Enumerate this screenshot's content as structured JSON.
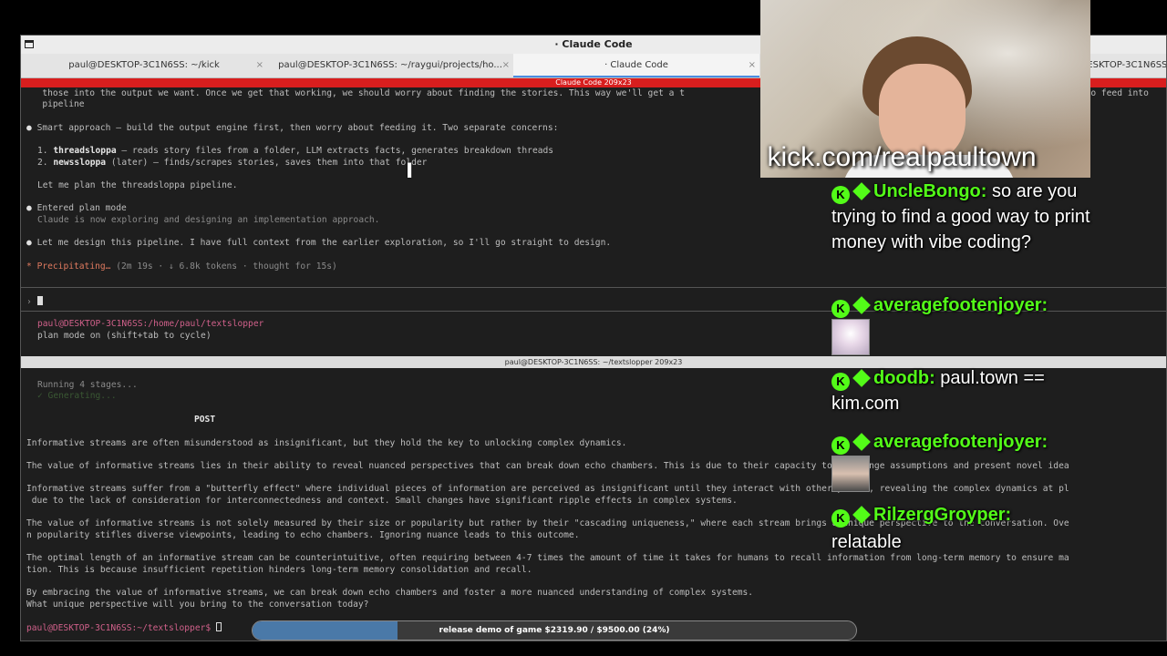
{
  "window": {
    "title": "· Claude Code"
  },
  "tabs": [
    {
      "label": "paul@DESKTOP-3C1N6SS: ~/kick"
    },
    {
      "label": "paul@DESKTOP-3C1N6SS: ~/raygui/projects/ho..."
    },
    {
      "label": "· Claude Code"
    },
    {
      "label": "paul@DESKTOP-3C1N6SS: ~/kick/kick"
    }
  ],
  "tab_close_glyph": "×",
  "top_pane": {
    "banner": "Claude Code 209x23",
    "lines": {
      "l1": "   those into the output we want. Once we get that working, we should worry about finding the stories. This way we'll get a t",
      "l1b": "e to feed into",
      "l2": "   pipeline",
      "l3": "Smart approach — build the output engine first, then worry about feeding it. Two separate concerns:",
      "l4_num": "1. ",
      "l4_bold": "threadsloppa",
      "l4_rest": " — reads story files from a folder, LLM extracts facts, generates breakdown threads",
      "l5_num": "2. ",
      "l5_bold": "newssloppa",
      "l5_rest": " (later) — finds/scrapes stories, saves them into that folder",
      "l6": "Let me plan the threadsloppa pipeline.",
      "l7": "Entered plan mode",
      "l8": "Claude is now exploring and designing an implementation approach.",
      "l9": "Let me design this pipeline. I have full context from the earlier exploration, so I'll go straight to design.",
      "l10_star": "* ",
      "l10_a": "Precipitating…",
      "l10_b": " (2m 19s · ↓ 6.8k tokens · thought for 15s)",
      "prompt": "›",
      "path": "paul@DESKTOP-3C1N6SS:/home/paul/textslopper",
      "mode": "plan mode on (shift+tab to cycle)"
    },
    "bullet": "●"
  },
  "bottom_pane": {
    "title": "paul@DESKTOP-3C1N6SS: ~/textslopper 209x23",
    "running": "Running 4 stages...",
    "done": "✓ Generating...",
    "heading": "POST",
    "p1": "Informative streams are often misunderstood as insignificant, but they hold the key to unlocking complex dynamics.",
    "p2": "The value of informative streams lies in their ability to reveal nuanced perspectives that can break down echo chambers. This is due to their capacity to challenge assumptions and present novel idea",
    "p3a": "Informative streams suffer from a \"butterfly effect\" where individual pieces of information are perceived as insignificant until they interact with other pieces, revealing the complex dynamics at pl",
    "p3b": " due to the lack of consideration for interconnectedness and context. Small changes have significant ripple effects in complex systems.",
    "p4a": "The value of informative streams is not solely measured by their size or popularity but rather by their \"cascading uniqueness,\" where each stream brings a unique perspective to the conversation. Ove",
    "p4b": "n popularity stifles diverse viewpoints, leading to echo chambers. Ignoring nuance leads to this outcome.",
    "p5a": "The optimal length of an informative stream can be counterintuitive, often requiring between 4-7 times the amount of time it takes for humans to recall information from long-term memory to ensure ma",
    "p5b": "tion. This is because insufficient repetition hinders long-term memory consolidation and recall.",
    "p6a": "By embracing the value of informative streams, we can break down echo chambers and foster a more nuanced understanding of complex systems.",
    "p6b": "What unique perspective will you bring to the conversation today?",
    "prompt": "paul@DESKTOP-3C1N6SS:~/textslopper$ "
  },
  "overlay": {
    "kick_url": "kick.com/realpaultown",
    "badge_letter": "K",
    "chat": [
      {
        "user": "UncleBongo:",
        "text": " so are you trying to find a good way to print money with vibe coding?"
      },
      {
        "user": "averagefootenjoyer:",
        "text": ""
      },
      {
        "user": "doodb:",
        "text": " paul.town == kim.com"
      },
      {
        "user": "averagefootenjoyer:",
        "text": ""
      },
      {
        "user": "RilzergGroyper:",
        "text": ""
      },
      {
        "user": "",
        "text": "relatable"
      }
    ],
    "progress": {
      "label": "release demo of game $2319.90 / $9500.00 (24%)",
      "fraction": 0.24
    },
    "colors": {
      "kick_green": "#53fc18",
      "banner_red": "#d81e1e",
      "progress_blue": "#4a79a8"
    }
  }
}
